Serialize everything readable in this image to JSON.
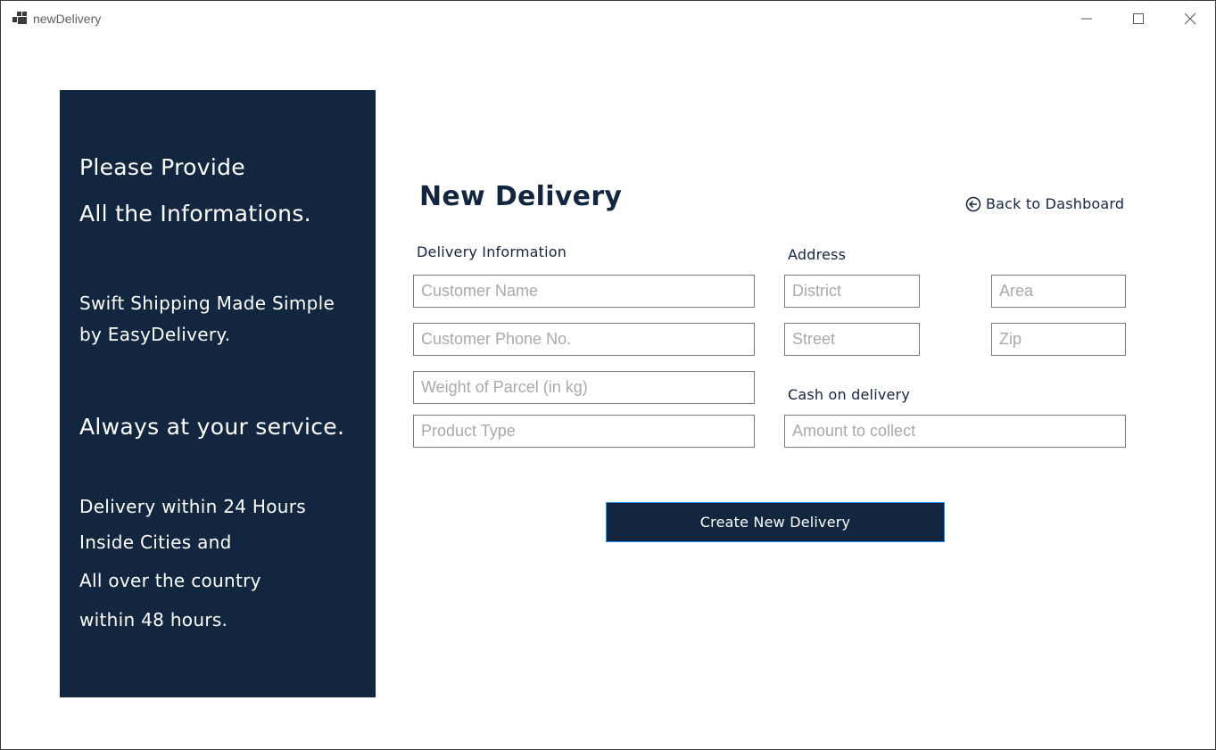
{
  "window": {
    "title": "newDelivery"
  },
  "sidebar": {
    "heading_line1": "Please Provide",
    "heading_line2": "All the Informations.",
    "tagline_line1": "Swift Shipping Made Simple",
    "tagline_line2": "by EasyDelivery.",
    "service": "Always at your service.",
    "delivery_line1": "Delivery within 24 Hours",
    "delivery_line2": "Inside Cities and",
    "delivery_line3": "All over the country",
    "delivery_line4": "within 48 hours."
  },
  "main": {
    "title": "New Delivery",
    "back_label": "Back to Dashboard",
    "delivery_info_label": "Delivery Information",
    "address_label": "Address",
    "cod_label": "Cash on delivery",
    "fields": {
      "customer_name": {
        "placeholder": "Customer Name",
        "value": ""
      },
      "customer_phone": {
        "placeholder": "Customer Phone No.",
        "value": ""
      },
      "weight": {
        "placeholder": "Weight of Parcel (in kg)",
        "value": ""
      },
      "product_type": {
        "placeholder": "Product Type",
        "value": ""
      },
      "district": {
        "placeholder": "District",
        "value": ""
      },
      "area": {
        "placeholder": "Area",
        "value": ""
      },
      "street": {
        "placeholder": "Street",
        "value": ""
      },
      "zip": {
        "placeholder": "Zip",
        "value": ""
      },
      "amount": {
        "placeholder": "Amount to collect",
        "value": ""
      }
    },
    "create_button_label": "Create New Delivery"
  },
  "colors": {
    "navy": "#13263f",
    "button_border": "#1e90ff",
    "input_border": "#7a7a7a",
    "placeholder": "#a9a9a9"
  },
  "icons": {
    "app": "app-window-icon",
    "back": "arrow-left-circle-icon",
    "minimize": "minimize-icon",
    "maximize": "maximize-icon",
    "close": "close-icon"
  }
}
